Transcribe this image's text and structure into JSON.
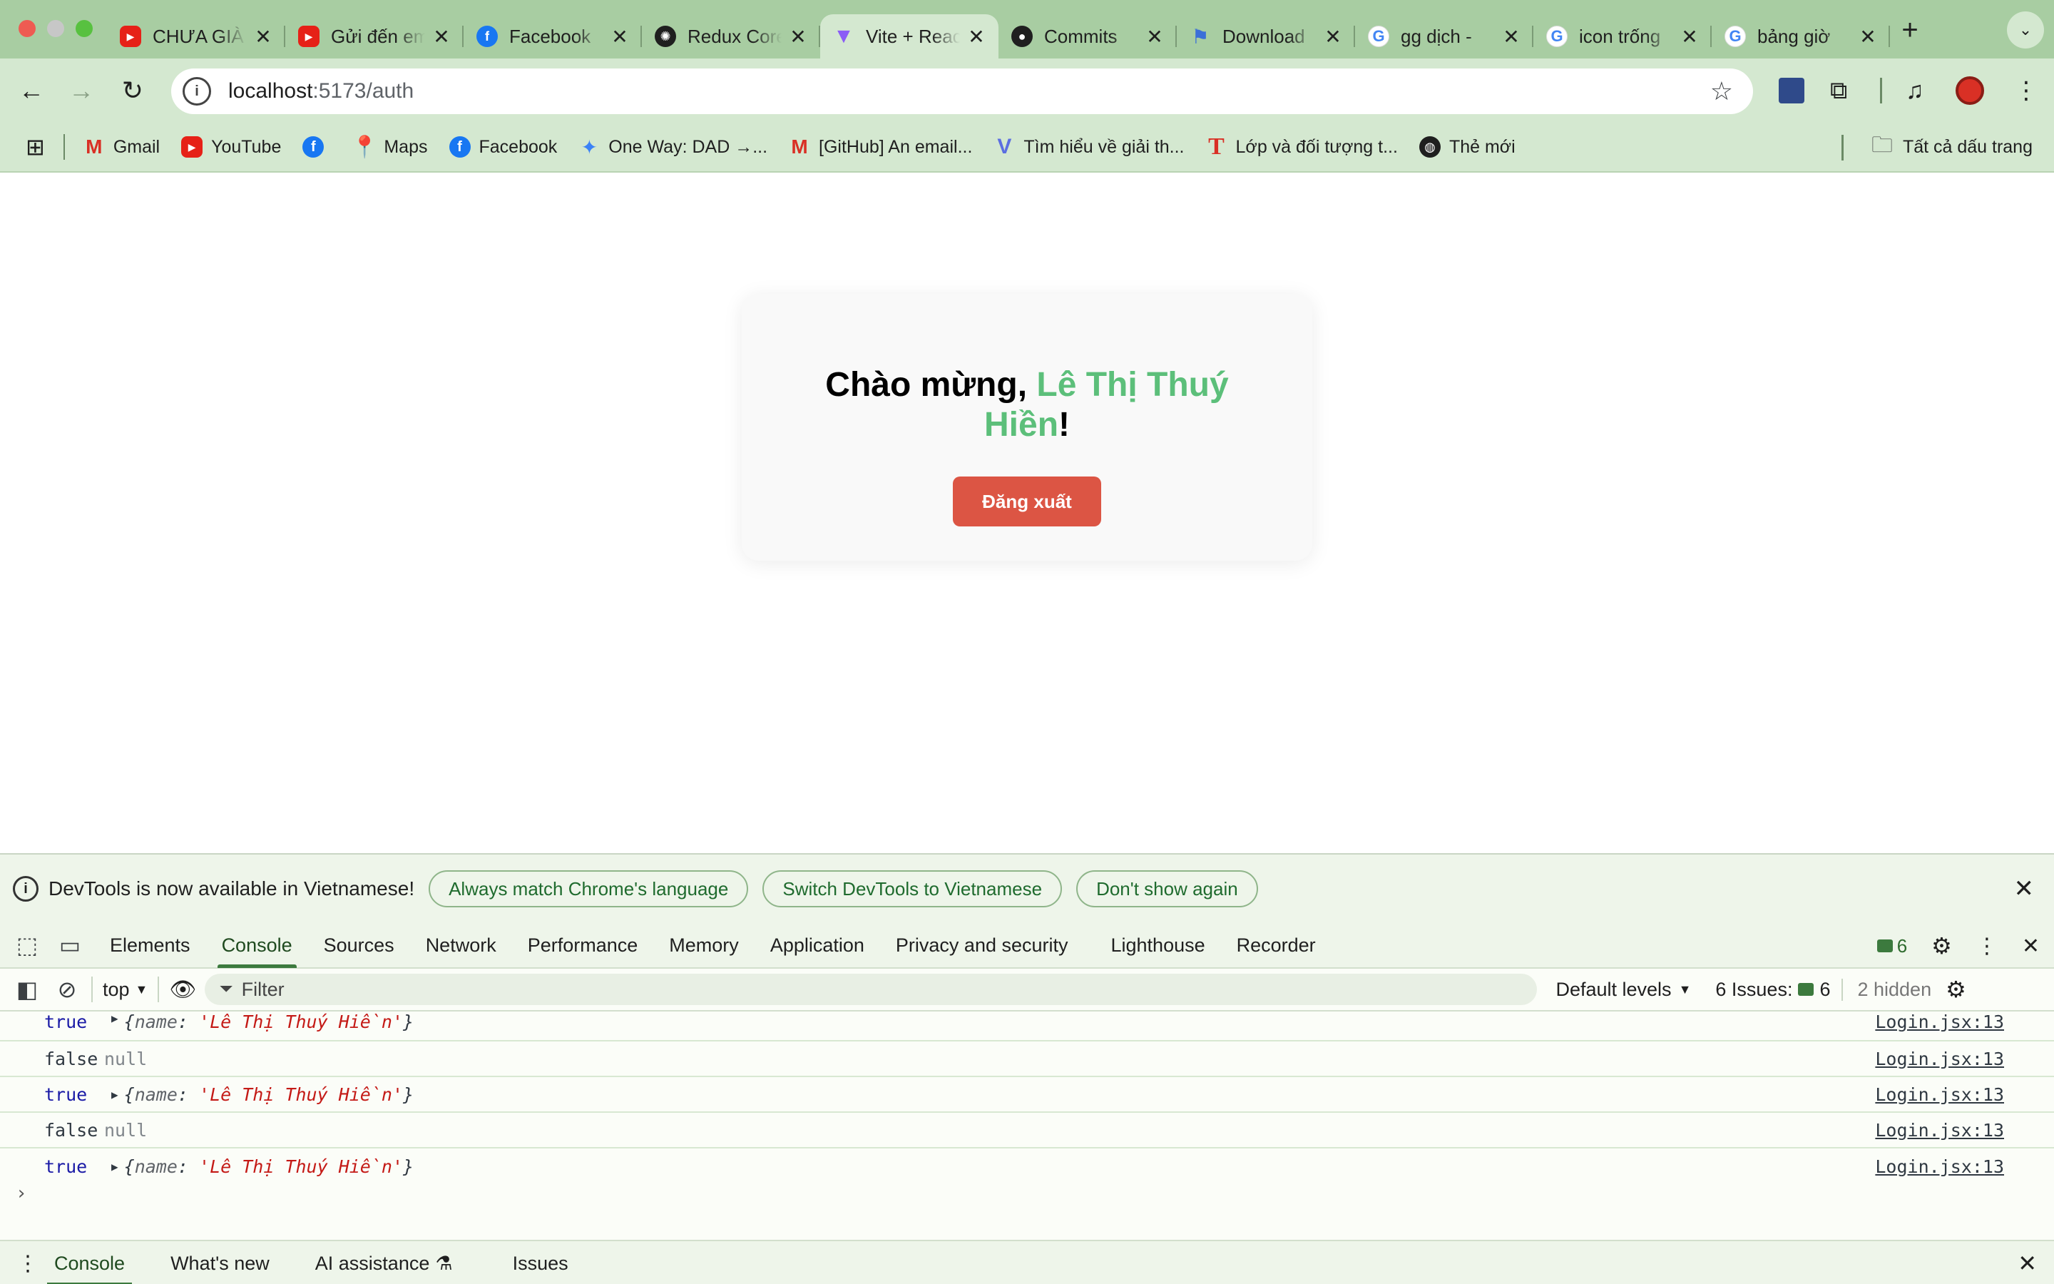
{
  "browser": {
    "tabs": [
      {
        "title": "CHƯA GIÀ",
        "icon": "youtube-icon"
      },
      {
        "title": "Gửi đến em",
        "icon": "youtube-icon"
      },
      {
        "title": "Facebook",
        "icon": "facebook-icon"
      },
      {
        "title": "Redux Core",
        "icon": "openai-icon"
      },
      {
        "title": "Vite + React",
        "icon": "vite-icon",
        "active": true
      },
      {
        "title": "Commits",
        "icon": "github-icon"
      },
      {
        "title": "Download",
        "icon": "flag-icon"
      },
      {
        "title": "gg dịch -",
        "icon": "google-icon"
      },
      {
        "title": "icon trống",
        "icon": "google-icon"
      },
      {
        "title": "bảng giờ",
        "icon": "google-icon"
      }
    ],
    "close_glyph": "✕",
    "new_tab": "+",
    "url_host": "localhost",
    "url_path": ":5173/auth",
    "bookmarks": [
      {
        "label": "Gmail",
        "icon": "gmail-icon"
      },
      {
        "label": "YouTube",
        "icon": "youtube-icon"
      },
      {
        "label": "",
        "icon": "facebook-icon"
      },
      {
        "label": "Maps",
        "icon": "maps-icon"
      },
      {
        "label": "Facebook",
        "icon": "facebook-icon"
      },
      {
        "label": "One Way: DAD →...",
        "icon": "bird-icon"
      },
      {
        "label": "[GitHub] An email...",
        "icon": "gmail-icon"
      },
      {
        "label": "Tìm hiểu về giải th...",
        "icon": "v-icon"
      },
      {
        "label": "Lớp và đối tượng t...",
        "icon": "t-icon"
      },
      {
        "label": "Thẻ mới",
        "icon": "globe-icon"
      }
    ],
    "all_bookmarks": "Tất cả dấu trang"
  },
  "page": {
    "welcome_prefix": "Chào mừng, ",
    "user_name": "Lê Thị Thuý Hiền",
    "welcome_suffix": "!",
    "logout_label": "Đăng xuất",
    "user_name_color": "#5cbf7a",
    "logout_color": "#dc5544"
  },
  "devtools": {
    "infobar": {
      "message": "DevTools is now available in Vietnamese!",
      "btn_match": "Always match Chrome's language",
      "btn_switch": "Switch DevTools to Vietnamese",
      "btn_dont": "Don't show again"
    },
    "tabs": [
      "Elements",
      "Console",
      "Sources",
      "Network",
      "Performance",
      "Memory",
      "Application",
      "Privacy and security",
      "Lighthouse",
      "Recorder"
    ],
    "active_tab": "Console",
    "message_count": "6",
    "filter": {
      "context": "top",
      "placeholder": "Filter",
      "levels": "Default levels",
      "issues_label": "6 Issues:",
      "issues_count": "6",
      "hidden": "2 hidden"
    },
    "console_rows": [
      {
        "bool": "true",
        "key": "name",
        "value": "'Lê Thị Thuý Hiền'",
        "source": "Login.jsx:13"
      },
      {
        "bool": "false",
        "null": "null",
        "source": "Login.jsx:13"
      },
      {
        "bool": "true",
        "key": "name",
        "value": "'Lê Thị Thuý Hiền'",
        "source": "Login.jsx:13"
      },
      {
        "bool": "false",
        "null": "null",
        "source": "Login.jsx:13"
      },
      {
        "bool": "true",
        "key": "name",
        "value": "'Lê Thị Thuý Hiền'",
        "source": "Login.jsx:13"
      }
    ],
    "drawer_tabs": [
      "Console",
      "What's new",
      "AI assistance",
      "Issues"
    ]
  }
}
